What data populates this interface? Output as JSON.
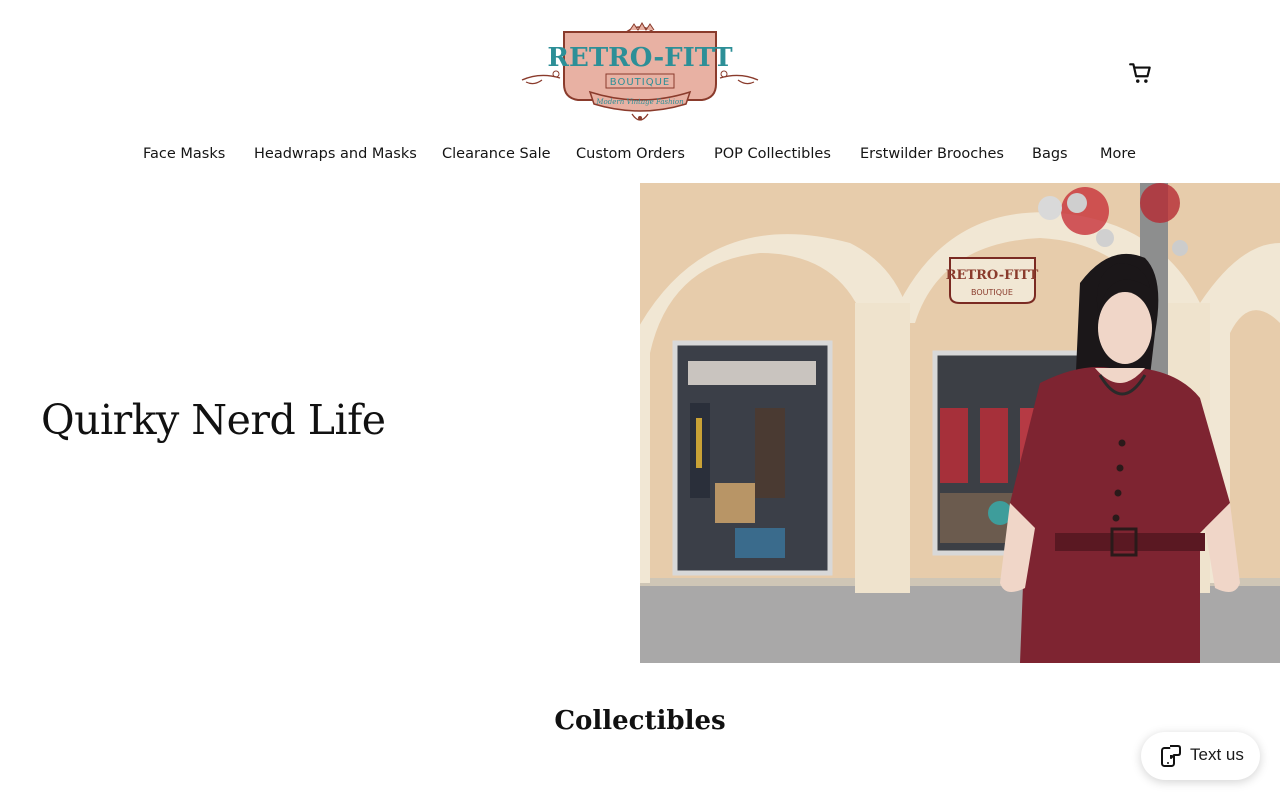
{
  "brand": {
    "logo_main": "RETRO-FITT",
    "logo_sub": "BOUTIQUE",
    "logo_tagline": "Modern Vintage Fashion",
    "colors": {
      "logo_pink": "#e8b1a3",
      "logo_teal": "#2d8f97",
      "logo_brown": "#8a3b2c"
    }
  },
  "header": {
    "cart_icon": "cart-icon"
  },
  "nav": {
    "items": [
      {
        "label": "Face Masks"
      },
      {
        "label": "Headwraps and Masks"
      },
      {
        "label": "Clearance Sale"
      },
      {
        "label": "Custom Orders"
      },
      {
        "label": "POP Collectibles"
      },
      {
        "label": "Erstwilder Brooches"
      },
      {
        "label": "Bags"
      },
      {
        "label": "More"
      }
    ]
  },
  "hero": {
    "title": "Quirky Nerd Life",
    "storefront_sign_main": "RETRO-FITT",
    "storefront_sign_sub": "BOUTIQUE"
  },
  "section": {
    "title": "Collectibles"
  },
  "chat_widget": {
    "label": "Text us",
    "icon": "message-phone-icon"
  }
}
